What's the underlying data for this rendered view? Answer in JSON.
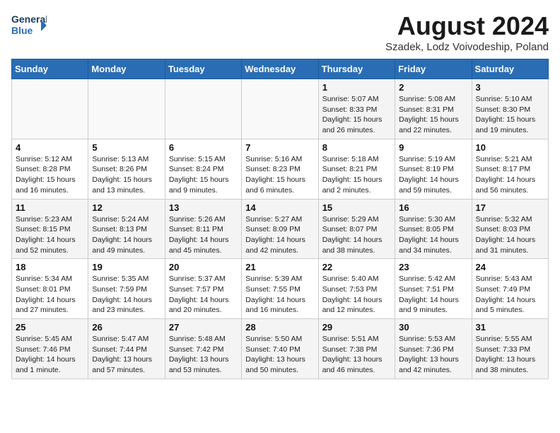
{
  "header": {
    "logo_line1": "General",
    "logo_line2": "Blue",
    "month_title": "August 2024",
    "location": "Szadek, Lodz Voivodeship, Poland"
  },
  "days_of_week": [
    "Sunday",
    "Monday",
    "Tuesday",
    "Wednesday",
    "Thursday",
    "Friday",
    "Saturday"
  ],
  "weeks": [
    [
      {
        "day": "",
        "info": ""
      },
      {
        "day": "",
        "info": ""
      },
      {
        "day": "",
        "info": ""
      },
      {
        "day": "",
        "info": ""
      },
      {
        "day": "1",
        "info": "Sunrise: 5:07 AM\nSunset: 8:33 PM\nDaylight: 15 hours\nand 26 minutes."
      },
      {
        "day": "2",
        "info": "Sunrise: 5:08 AM\nSunset: 8:31 PM\nDaylight: 15 hours\nand 22 minutes."
      },
      {
        "day": "3",
        "info": "Sunrise: 5:10 AM\nSunset: 8:30 PM\nDaylight: 15 hours\nand 19 minutes."
      }
    ],
    [
      {
        "day": "4",
        "info": "Sunrise: 5:12 AM\nSunset: 8:28 PM\nDaylight: 15 hours\nand 16 minutes."
      },
      {
        "day": "5",
        "info": "Sunrise: 5:13 AM\nSunset: 8:26 PM\nDaylight: 15 hours\nand 13 minutes."
      },
      {
        "day": "6",
        "info": "Sunrise: 5:15 AM\nSunset: 8:24 PM\nDaylight: 15 hours\nand 9 minutes."
      },
      {
        "day": "7",
        "info": "Sunrise: 5:16 AM\nSunset: 8:23 PM\nDaylight: 15 hours\nand 6 minutes."
      },
      {
        "day": "8",
        "info": "Sunrise: 5:18 AM\nSunset: 8:21 PM\nDaylight: 15 hours\nand 2 minutes."
      },
      {
        "day": "9",
        "info": "Sunrise: 5:19 AM\nSunset: 8:19 PM\nDaylight: 14 hours\nand 59 minutes."
      },
      {
        "day": "10",
        "info": "Sunrise: 5:21 AM\nSunset: 8:17 PM\nDaylight: 14 hours\nand 56 minutes."
      }
    ],
    [
      {
        "day": "11",
        "info": "Sunrise: 5:23 AM\nSunset: 8:15 PM\nDaylight: 14 hours\nand 52 minutes."
      },
      {
        "day": "12",
        "info": "Sunrise: 5:24 AM\nSunset: 8:13 PM\nDaylight: 14 hours\nand 49 minutes."
      },
      {
        "day": "13",
        "info": "Sunrise: 5:26 AM\nSunset: 8:11 PM\nDaylight: 14 hours\nand 45 minutes."
      },
      {
        "day": "14",
        "info": "Sunrise: 5:27 AM\nSunset: 8:09 PM\nDaylight: 14 hours\nand 42 minutes."
      },
      {
        "day": "15",
        "info": "Sunrise: 5:29 AM\nSunset: 8:07 PM\nDaylight: 14 hours\nand 38 minutes."
      },
      {
        "day": "16",
        "info": "Sunrise: 5:30 AM\nSunset: 8:05 PM\nDaylight: 14 hours\nand 34 minutes."
      },
      {
        "day": "17",
        "info": "Sunrise: 5:32 AM\nSunset: 8:03 PM\nDaylight: 14 hours\nand 31 minutes."
      }
    ],
    [
      {
        "day": "18",
        "info": "Sunrise: 5:34 AM\nSunset: 8:01 PM\nDaylight: 14 hours\nand 27 minutes."
      },
      {
        "day": "19",
        "info": "Sunrise: 5:35 AM\nSunset: 7:59 PM\nDaylight: 14 hours\nand 23 minutes."
      },
      {
        "day": "20",
        "info": "Sunrise: 5:37 AM\nSunset: 7:57 PM\nDaylight: 14 hours\nand 20 minutes."
      },
      {
        "day": "21",
        "info": "Sunrise: 5:39 AM\nSunset: 7:55 PM\nDaylight: 14 hours\nand 16 minutes."
      },
      {
        "day": "22",
        "info": "Sunrise: 5:40 AM\nSunset: 7:53 PM\nDaylight: 14 hours\nand 12 minutes."
      },
      {
        "day": "23",
        "info": "Sunrise: 5:42 AM\nSunset: 7:51 PM\nDaylight: 14 hours\nand 9 minutes."
      },
      {
        "day": "24",
        "info": "Sunrise: 5:43 AM\nSunset: 7:49 PM\nDaylight: 14 hours\nand 5 minutes."
      }
    ],
    [
      {
        "day": "25",
        "info": "Sunrise: 5:45 AM\nSunset: 7:46 PM\nDaylight: 14 hours\nand 1 minute."
      },
      {
        "day": "26",
        "info": "Sunrise: 5:47 AM\nSunset: 7:44 PM\nDaylight: 13 hours\nand 57 minutes."
      },
      {
        "day": "27",
        "info": "Sunrise: 5:48 AM\nSunset: 7:42 PM\nDaylight: 13 hours\nand 53 minutes."
      },
      {
        "day": "28",
        "info": "Sunrise: 5:50 AM\nSunset: 7:40 PM\nDaylight: 13 hours\nand 50 minutes."
      },
      {
        "day": "29",
        "info": "Sunrise: 5:51 AM\nSunset: 7:38 PM\nDaylight: 13 hours\nand 46 minutes."
      },
      {
        "day": "30",
        "info": "Sunrise: 5:53 AM\nSunset: 7:36 PM\nDaylight: 13 hours\nand 42 minutes."
      },
      {
        "day": "31",
        "info": "Sunrise: 5:55 AM\nSunset: 7:33 PM\nDaylight: 13 hours\nand 38 minutes."
      }
    ]
  ]
}
